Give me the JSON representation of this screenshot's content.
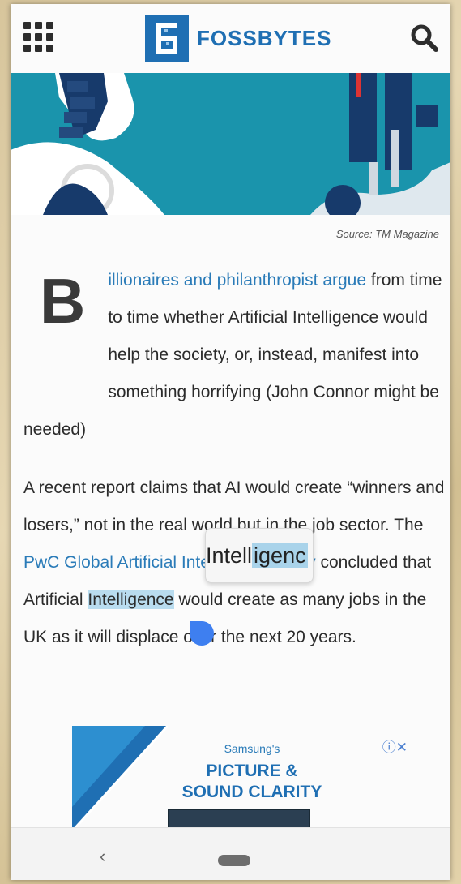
{
  "header": {
    "logo_text": "FOSSBYTES",
    "brand_color": "#1f6fb3",
    "menu_icon": "grid-menu-icon",
    "search_icon": "search-icon"
  },
  "hero": {
    "caption": "Source: TM Magazine",
    "background_color": "#1a94ac"
  },
  "article": {
    "drop_cap": "B",
    "p1_link": "illionaires and philanthropist argue",
    "p1_rest": " from time to time whether Artificial Intelligence would help the society, or, instead, manifest into something horrifying (John Connor might be needed)",
    "p2_before": "A recent report claims that AI would create “winners and losers,” not in the r",
    "p2_hidden": "eal world but",
    "p2_mid": " in the job sector. The ",
    "p2_link": "PwC Global Artificial Intelligence Study",
    "p2_after1": " concluded that Artificial ",
    "p2_selected": "Intelligence",
    "p2_after2": " would create as many jobs in the UK as it will displace over the next 20 years.",
    "magnifier_text_before": "Intell",
    "magnifier_text_hl": "igenc",
    "selection_color": "#b9dcef"
  },
  "ad": {
    "brand": "Samsung's",
    "line1": "PICTURE &",
    "line2": "SOUND CLARITY",
    "close_label": "ⓘ✕"
  },
  "navbar": {
    "back_label": "‹"
  }
}
